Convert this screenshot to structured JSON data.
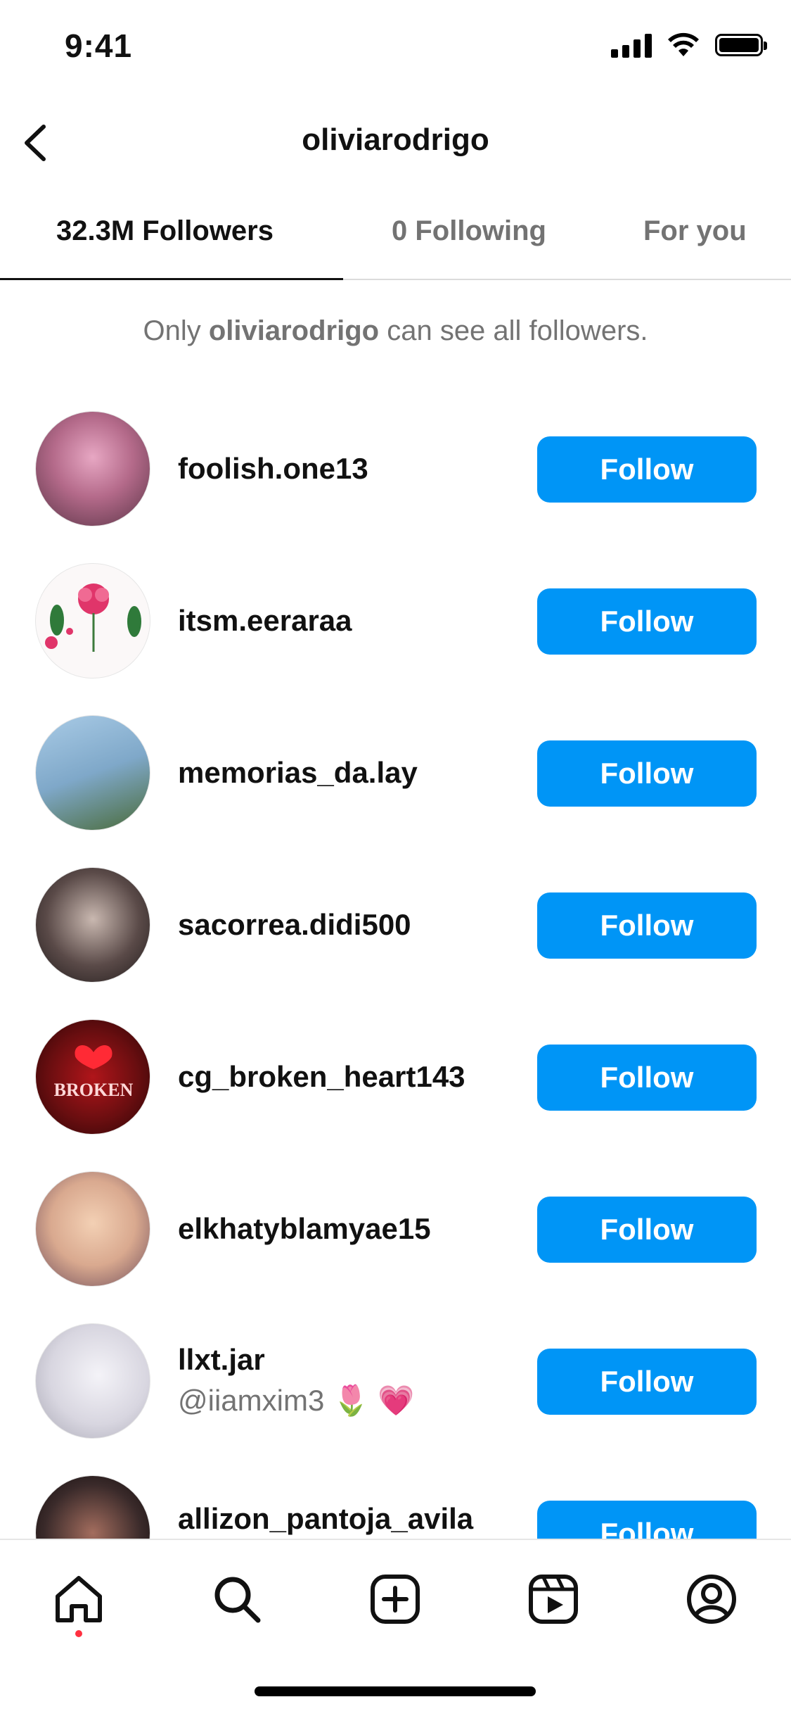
{
  "status_bar": {
    "time": "9:41"
  },
  "header": {
    "title": "oliviarodrigo"
  },
  "tabs": [
    {
      "label": "32.3M Followers",
      "active": true
    },
    {
      "label": "0 Following",
      "active": false
    },
    {
      "label": "For you",
      "active": false
    }
  ],
  "notice": {
    "prefix": "Only ",
    "name": "oliviarodrigo",
    "suffix": " can see all followers."
  },
  "followers": [
    {
      "username": "foolish.one13",
      "subtitle": "",
      "button": "Follow",
      "avatar_color": "#b46a8a"
    },
    {
      "username": "itsm.eeraraa",
      "subtitle": "",
      "button": "Follow",
      "avatar_color": "#f4eef0"
    },
    {
      "username": "memorias_da.lay",
      "subtitle": "",
      "button": "Follow",
      "avatar_color": "#7fa8c9"
    },
    {
      "username": "sacorrea.didi500",
      "subtitle": "",
      "button": "Follow",
      "avatar_color": "#5a4a48"
    },
    {
      "username": "cg_broken_heart143",
      "subtitle": "",
      "button": "Follow",
      "avatar_color": "#6a0e10"
    },
    {
      "username": "elkhatyblamyae15",
      "subtitle": "",
      "button": "Follow",
      "avatar_color": "#d9a98f"
    },
    {
      "username": "llxt.jar",
      "subtitle": "@iiamxim3 🌷 💗",
      "button": "Follow",
      "avatar_color": "#d8d6e0"
    },
    {
      "username": "allizon_pantoja_avila",
      "subtitle": "",
      "button": "Follow",
      "avatar_color": "#3a2a2a"
    }
  ],
  "colors": {
    "accent": "#0095f6",
    "notification_dot": "#ff3040"
  },
  "nav": [
    {
      "icon": "home-icon"
    },
    {
      "icon": "search-icon"
    },
    {
      "icon": "create-icon"
    },
    {
      "icon": "reels-icon"
    },
    {
      "icon": "profile-icon"
    }
  ]
}
